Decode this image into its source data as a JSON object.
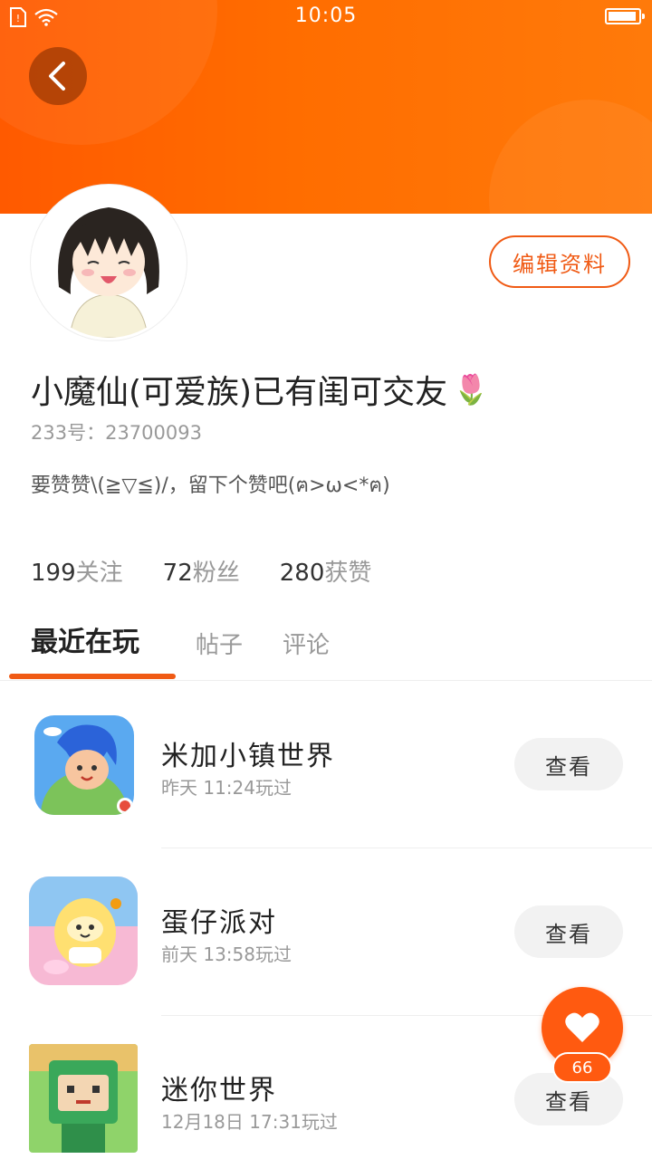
{
  "status_bar": {
    "time": "10:05",
    "icons": [
      "sim-card-icon",
      "wifi-icon",
      "battery-icon"
    ]
  },
  "header": {
    "back_icon": "chevron-left-icon",
    "accent_color": "#ff6a00"
  },
  "profile": {
    "edit_label": "编辑资料",
    "name": "小魔仙(可爱族)已有闺可交友",
    "name_emoji": "🌷",
    "uid": "233号：23700093",
    "bio": "要赞赞\\(≧▽≦)/，留下个赞吧(ฅ>ω<*ฅ)"
  },
  "stats": [
    {
      "num": "199",
      "label": "关注"
    },
    {
      "num": "72",
      "label": "粉丝"
    },
    {
      "num": "280",
      "label": "获赞"
    }
  ],
  "tabs": [
    {
      "label": "最近在玩",
      "active": true
    },
    {
      "label": "帖子",
      "active": false
    },
    {
      "label": "评论",
      "active": false
    }
  ],
  "games": [
    {
      "name": "米加小镇世界",
      "time": "昨天 11:24玩过",
      "button": "查看"
    },
    {
      "name": "蛋仔派对",
      "time": "前天 13:58玩过",
      "button": "查看"
    },
    {
      "name": "迷你世界",
      "time": "12月18日 17:31玩过",
      "button": "查看"
    }
  ],
  "like_fab": {
    "icon": "heart-icon",
    "count": "66"
  }
}
